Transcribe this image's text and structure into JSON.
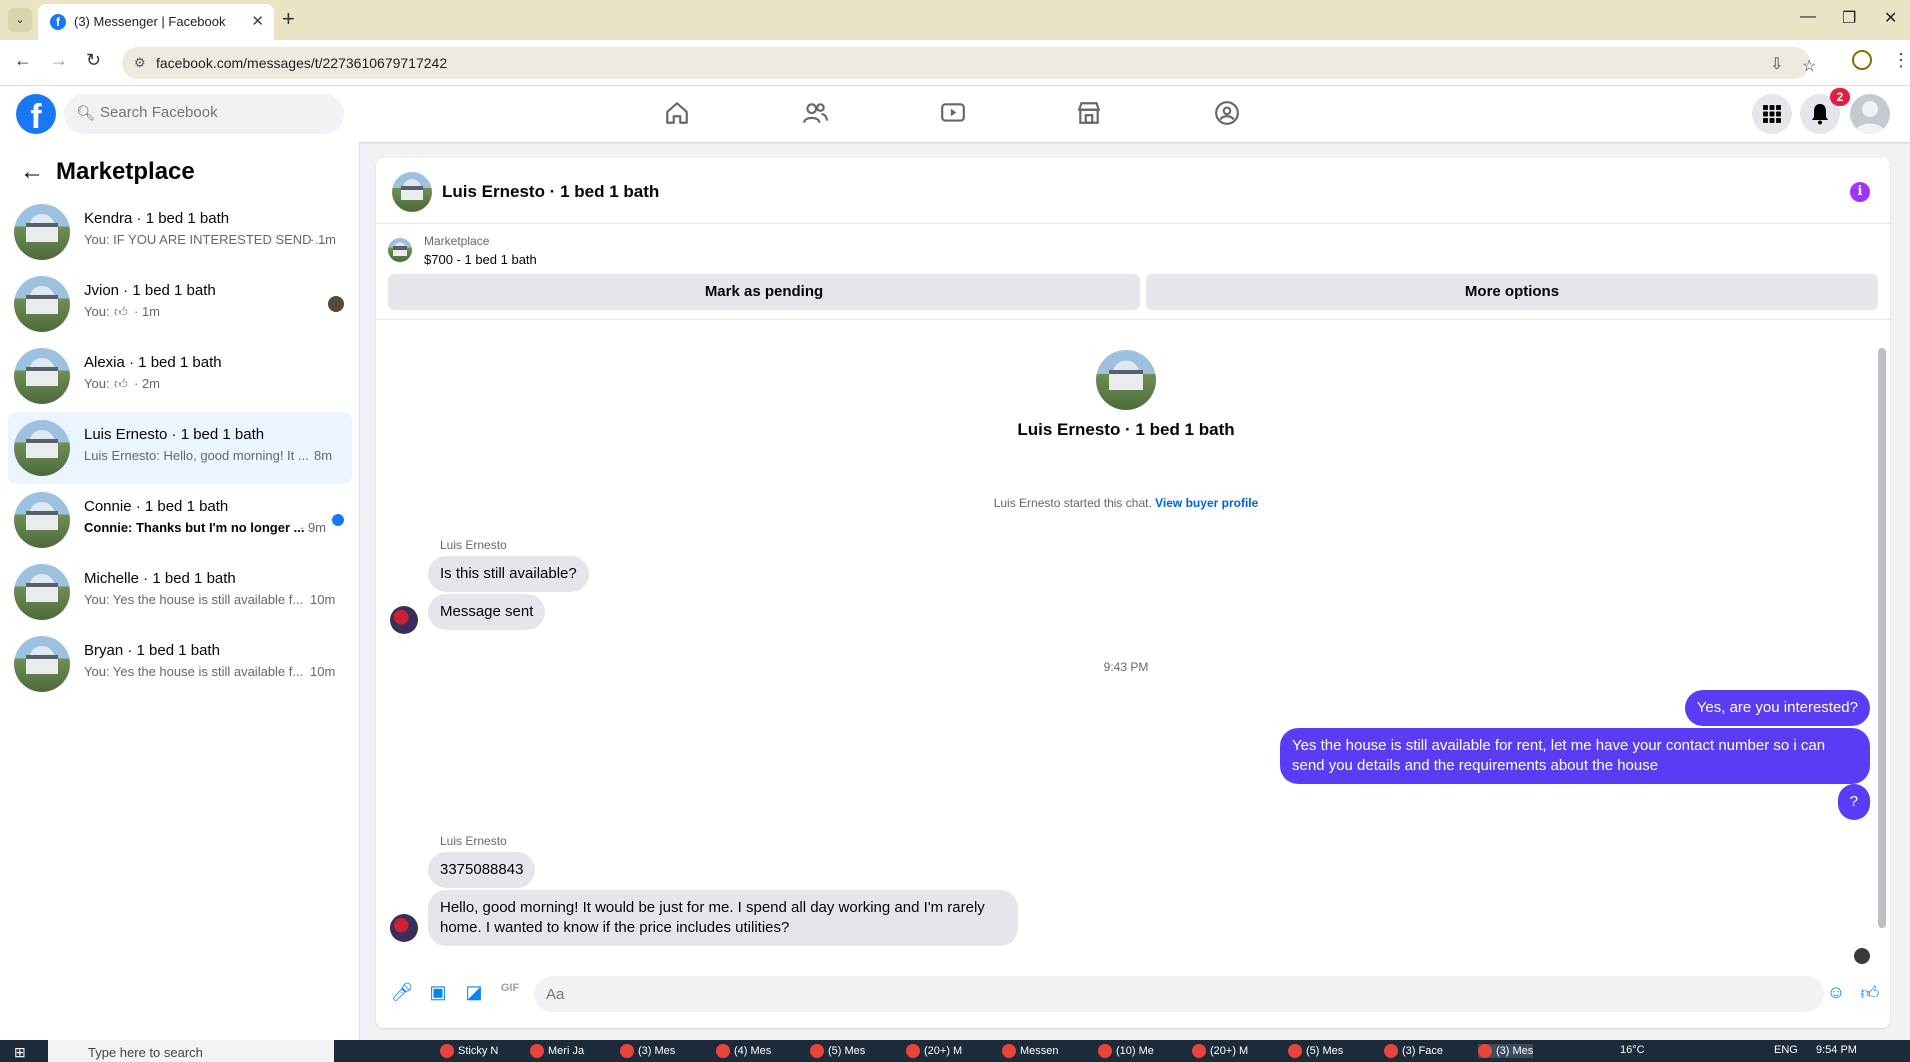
{
  "browser": {
    "tab_title": "(3) Messenger | Facebook",
    "url": "facebook.com/messages/t/2273610679717242"
  },
  "fb": {
    "search_placeholder": "Search Facebook",
    "notification_count": "2"
  },
  "sidebar": {
    "title": "Marketplace",
    "conversations": [
      {
        "name": "Kendra · 1 bed 1 bath",
        "snippet": "You: IF YOU ARE INTERESTED SEND ...",
        "time": "· 1m"
      },
      {
        "name": "Jvion · 1 bed 1 bath",
        "snippet": "You:",
        "time": "· 1m"
      },
      {
        "name": "Alexia · 1 bed 1 bath",
        "snippet": "You:",
        "time": "· 2m"
      },
      {
        "name": "Luis Ernesto · 1 bed 1 bath",
        "snippet": "Luis Ernesto: Hello, good morning! It ...",
        "time": "8m"
      },
      {
        "name": "Connie · 1 bed 1 bath",
        "snippet": "Connie: Thanks but I'm no longer ...",
        "time": "· 9m"
      },
      {
        "name": "Michelle · 1 bed 1 bath",
        "snippet": "You: Yes the house is still available f...",
        "time": "10m"
      },
      {
        "name": "Bryan · 1 bed 1 bath",
        "snippet": "You: Yes the house is still available f...",
        "time": "10m"
      }
    ]
  },
  "chat": {
    "title": "Luis Ernesto · 1 bed 1 bath",
    "listing_label": "Marketplace",
    "listing_price": "$700 - 1 bed 1 bath",
    "mark_pending": "Mark as pending",
    "more_options": "More options",
    "started_text": "Luis Ernesto started this chat.",
    "view_profile": "View buyer profile",
    "sender_name": "Luis Ernesto",
    "msg1": "Is this still available?",
    "msg2": "Message sent",
    "timestamp": "9:43 PM",
    "out1": "Yes, are you interested?",
    "out2": "Yes the house is still available for rent, let me have your contact number so i can send you details and the requirements about the house",
    "out3": "?",
    "msg3": "3375088843",
    "msg4": "Hello, good morning! It would be just for me. I spend all day working and I'm rarely home. I wanted to know if the price includes utilities?",
    "composer_placeholder": "Aa"
  },
  "taskbar": {
    "search_placeholder": "Type here to search",
    "items": [
      "Sticky N",
      "Meri Ja",
      "(3) Mes",
      "(4) Mes",
      "(5) Mes",
      "(20+) M",
      "Messen",
      "(10) Me",
      "(20+) M",
      "(5) Mes",
      "(3) Face",
      "(3) Mes"
    ],
    "weather": "16°C",
    "lang": "ENG",
    "clock": "9:54 PM"
  }
}
